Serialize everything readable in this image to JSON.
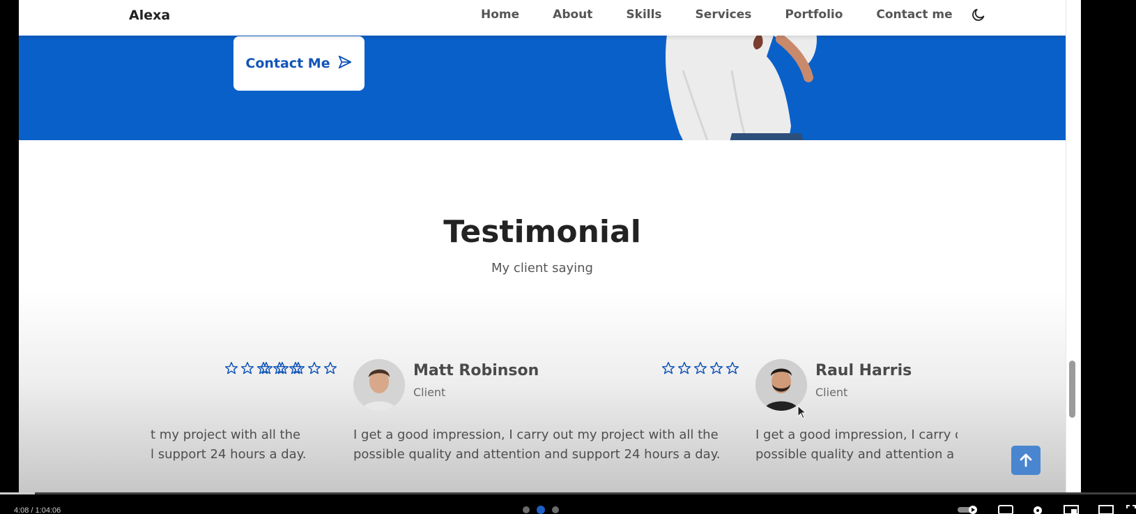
{
  "header": {
    "logo": "Alexa",
    "nav": [
      {
        "label": "Home"
      },
      {
        "label": "About"
      },
      {
        "label": "Skills"
      },
      {
        "label": "Services"
      },
      {
        "label": "Portfolio"
      },
      {
        "label": "Contact me"
      }
    ],
    "theme_icon": "moon-icon"
  },
  "hero": {
    "contact_button": "Contact Me",
    "contact_icon": "send-icon"
  },
  "testimonial": {
    "title": "Testimonial",
    "subtitle": "My client saying",
    "cards": [
      {
        "name": "",
        "role": "",
        "text_line1": "t my project with all the",
        "text_line2": "l support 24 hours a day.",
        "stars": 5
      },
      {
        "name": "Matt Robinson",
        "role": "Client",
        "text_line1": "I get a good impression, I carry out my project with all the",
        "text_line2": "possible quality and attention and support 24 hours a day.",
        "stars": 5
      },
      {
        "name": "Raul Harris",
        "role": "Client",
        "text_line1": "I get a good impression, I carry o",
        "text_line2": "possible quality and attention a",
        "stars": 5
      }
    ],
    "pagination": {
      "count": 3,
      "active_index": 1
    }
  },
  "player": {
    "time": "4:08 / 1:04:06"
  },
  "colors": {
    "brand_blue": "#0a60c9",
    "button_text": "#1255b8",
    "scroll_up_bg": "#4a86cf"
  }
}
